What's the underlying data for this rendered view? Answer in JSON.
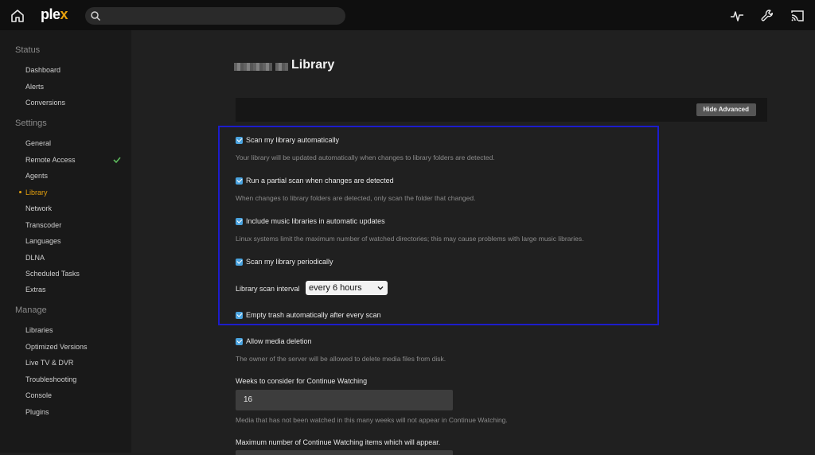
{
  "app": {
    "logo_text": "ple",
    "logo_accent": "x"
  },
  "search": {
    "placeholder": ""
  },
  "sidebar": {
    "sections": [
      {
        "title": "Status",
        "items": [
          "Dashboard",
          "Alerts",
          "Conversions"
        ]
      },
      {
        "title": "Settings",
        "items": [
          "General",
          "Remote Access",
          "Agents",
          "Library",
          "Network",
          "Transcoder",
          "Languages",
          "DLNA",
          "Scheduled Tasks",
          "Extras"
        ]
      },
      {
        "title": "Manage",
        "items": [
          "Libraries",
          "Optimized Versions",
          "Live TV & DVR",
          "Troubleshooting",
          "Console",
          "Plugins"
        ]
      }
    ],
    "active_item": "Library"
  },
  "main": {
    "title": "Library",
    "hide_advanced_label": "Hide Advanced",
    "options": {
      "scan_auto": {
        "label": "Scan my library automatically",
        "desc": "Your library will be updated automatically when changes to library folders are detected.",
        "checked": true
      },
      "partial_scan": {
        "label": "Run a partial scan when changes are detected",
        "desc": "When changes to library folders are detected, only scan the folder that changed.",
        "checked": true
      },
      "music_libs": {
        "label": "Include music libraries in automatic updates",
        "desc": "Linux systems limit the maximum number of watched directories; this may cause problems with large music libraries.",
        "checked": true
      },
      "scan_periodic": {
        "label": "Scan my library periodically",
        "checked": true
      },
      "empty_trash": {
        "label": "Empty trash automatically after every scan",
        "checked": true
      },
      "allow_deletion": {
        "label": "Allow media deletion",
        "desc": "The owner of the server will be allowed to delete media files from disk.",
        "checked": true
      }
    },
    "scan_interval": {
      "label": "Library scan interval",
      "value": "every 6 hours"
    },
    "continue_watching_weeks": {
      "label": "Weeks to consider for Continue Watching",
      "value": "16",
      "desc": "Media that has not been watched in this many weeks will not appear in Continue Watching."
    },
    "max_continue_items": {
      "label": "Maximum number of Continue Watching items which will appear."
    }
  },
  "colors": {
    "accent": "#e5a00d",
    "checkbox": "#4aa3df",
    "highlight": "#1c1ccc"
  }
}
